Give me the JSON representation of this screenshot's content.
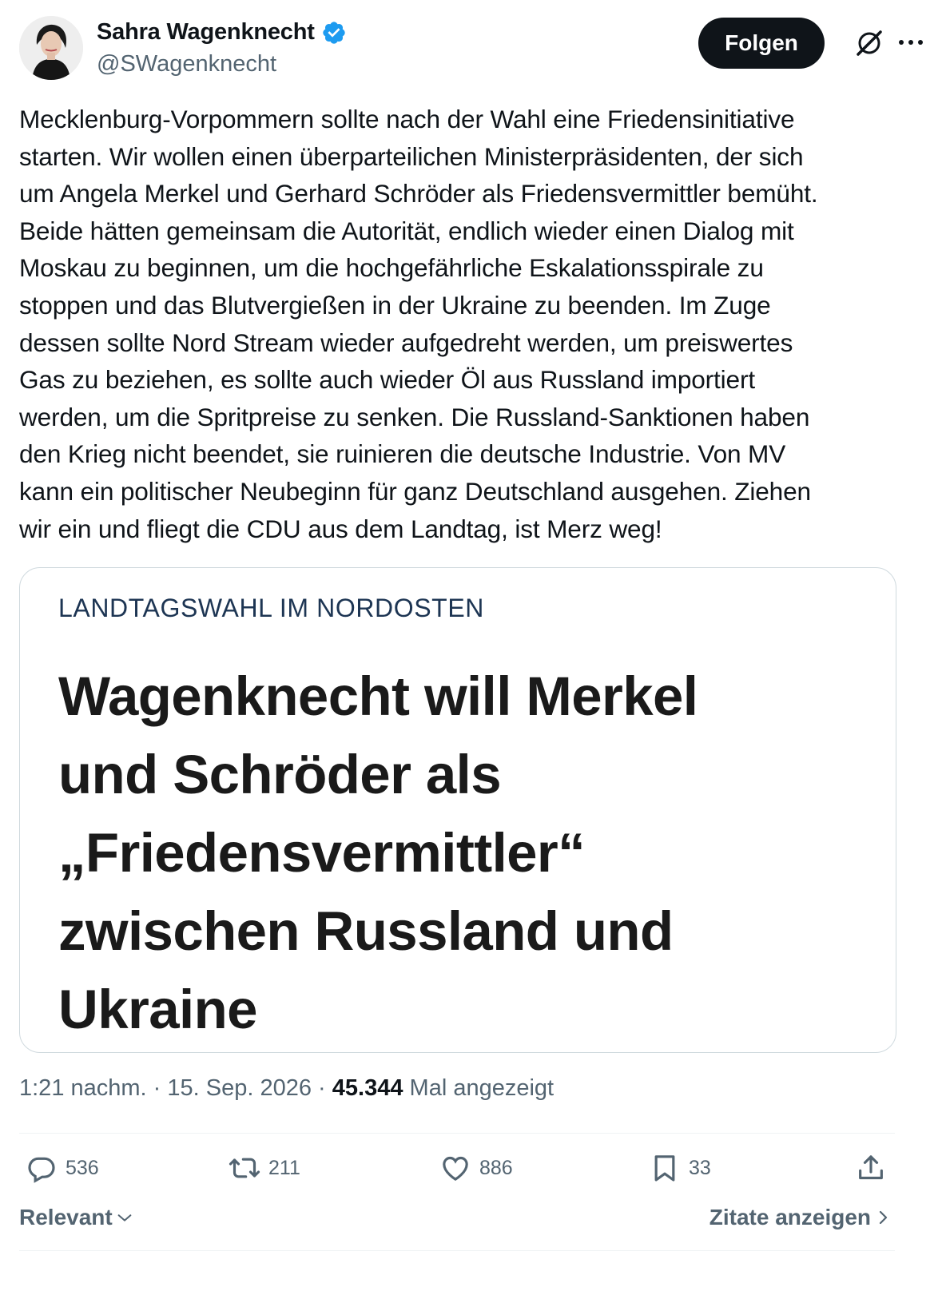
{
  "author": {
    "name": "Sahra Wagenknecht",
    "handle": "@SWagenknecht",
    "verified": true,
    "verified_color": "#1d9bf0"
  },
  "header": {
    "follow_label": "Folgen",
    "grok_icon": "grok-icon",
    "more_icon": "more-icon"
  },
  "tweet": {
    "text": "Mecklenburg-Vorpommern sollte nach der Wahl eine Friedensinitiative\nstarten. Wir wollen einen überparteilichen Ministerpräsidenten, der sich\num Angela Merkel und Gerhard Schröder als Friedensvermittler bemüht.\nBeide hätten gemeinsam die Autorität, endlich wieder einen Dialog mit\nMoskau zu beginnen, um die hochgefährliche Eskalationsspirale zu\nstoppen und das Blutvergießen in der Ukraine zu beenden. Im Zuge\ndessen sollte Nord Stream wieder aufgedreht werden, um preiswertes\nGas zu beziehen, es sollte auch wieder Öl aus Russland importiert\nwerden, um die Spritpreise zu senken. Die Russland-Sanktionen haben\nden Krieg nicht beendet, sie ruinieren die deutsche Industrie. Von MV\nkann ein politischer Neubeginn für ganz Deutschland ausgehen. Ziehen\nwir ein und fliegt die CDU aus dem Landtag, ist Merz weg!"
  },
  "card": {
    "kicker": "LANDTAGSWAHL IM NORDOSTEN",
    "headline": "Wagenknecht will Merkel\nund Schröder als\n„Friedensvermittler“\nzwischen Russland und\nUkraine"
  },
  "meta": {
    "time": "1:21 nachm.",
    "separator": " · ",
    "date": "15. Sep. 2026",
    "views": "45.344",
    "views_label": "Mal angezeigt"
  },
  "actions": {
    "replies": "536",
    "reposts": "211",
    "likes": "886",
    "bookmarks": "33"
  },
  "footer": {
    "sort_label": "Relevant",
    "quotes_label": "Zitate anzeigen"
  }
}
